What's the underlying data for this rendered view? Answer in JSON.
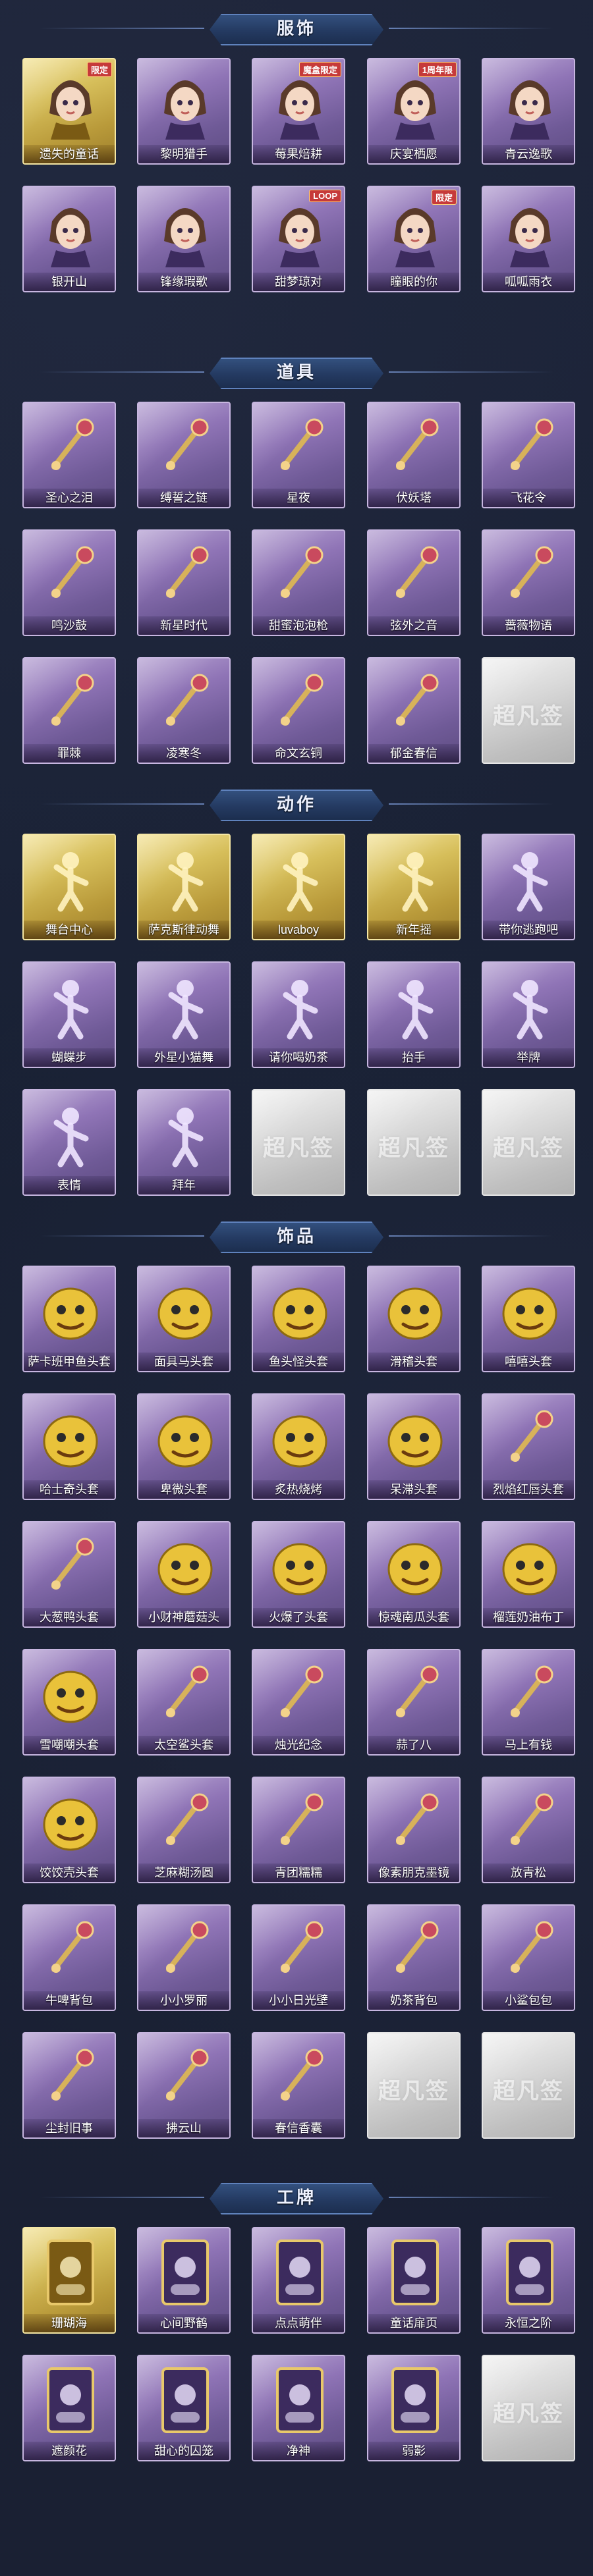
{
  "colors": {
    "purple_card": "#8f74b6",
    "gold_card": "#d6be5a",
    "gray_card": "#d8d8d8",
    "header_plate": "#243a61",
    "background": "#1b2236"
  },
  "placeholder_label": "超凡签",
  "sections": [
    {
      "title": "服饰",
      "items": [
        {
          "label": "遗失的童话",
          "rarity": "gold",
          "badge": "限定",
          "icon": "princess-costume-icon"
        },
        {
          "label": "黎明猎手",
          "rarity": "purple",
          "icon": "hunter-costume-icon"
        },
        {
          "label": "莓果焙耕",
          "rarity": "purple",
          "badge": "魔盒限定",
          "icon": "berry-costume-icon"
        },
        {
          "label": "庆宴栖愿",
          "rarity": "purple",
          "badge": "1周年限",
          "icon": "feast-costume-icon"
        },
        {
          "label": "青云逸歌",
          "rarity": "purple",
          "icon": "cloud-costume-icon"
        },
        {
          "label": "银开山",
          "rarity": "purple",
          "icon": "mountain-costume-icon"
        },
        {
          "label": "锋缘瑕歌",
          "rarity": "purple",
          "icon": "blade-costume-icon"
        },
        {
          "label": "甜梦琼对",
          "rarity": "purple",
          "badge": "LOOP",
          "icon": "dream-costume-icon"
        },
        {
          "label": "瞳眼的你",
          "rarity": "purple",
          "badge": "限定",
          "icon": "cowgirl-costume-icon"
        },
        {
          "label": "呱呱雨衣",
          "rarity": "purple",
          "icon": "frog-raincoat-icon"
        }
      ]
    },
    {
      "title": "道具",
      "items": [
        {
          "label": "圣心之泪",
          "rarity": "purple",
          "icon": "scepter-icon"
        },
        {
          "label": "缚誓之链",
          "rarity": "purple",
          "icon": "chain-icon"
        },
        {
          "label": "星夜",
          "rarity": "purple",
          "icon": "star-staff-icon"
        },
        {
          "label": "伏妖塔",
          "rarity": "purple",
          "icon": "pagoda-icon"
        },
        {
          "label": "飞花令",
          "rarity": "purple",
          "icon": "flower-fan-icon"
        },
        {
          "label": "鸣沙鼓",
          "rarity": "purple",
          "icon": "drum-icon"
        },
        {
          "label": "新星时代",
          "rarity": "purple",
          "icon": "revolver-icon"
        },
        {
          "label": "甜蜜泡泡枪",
          "rarity": "purple",
          "icon": "bubble-gun-icon"
        },
        {
          "label": "弦外之音",
          "rarity": "purple",
          "icon": "guitar-icon"
        },
        {
          "label": "蔷薇物语",
          "rarity": "purple",
          "icon": "first-aid-kit-icon"
        },
        {
          "label": "罪棘",
          "rarity": "purple",
          "icon": "thorn-spear-icon"
        },
        {
          "label": "凌寒冬",
          "rarity": "purple",
          "icon": "ice-sword-icon"
        },
        {
          "label": "命文玄铜",
          "rarity": "purple",
          "icon": "bronze-bell-icon"
        },
        {
          "label": "郁金春信",
          "rarity": "purple",
          "icon": "tulip-umbrella-icon"
        },
        {
          "label": "",
          "rarity": "gray",
          "placeholder": true
        }
      ]
    },
    {
      "title": "动作",
      "items": [
        {
          "label": "舞台中心",
          "rarity": "gold",
          "icon": "pose-center-icon"
        },
        {
          "label": "萨克斯律动舞",
          "rarity": "gold",
          "icon": "pose-sax-icon"
        },
        {
          "label": "luvaboy",
          "rarity": "gold",
          "icon": "pose-heart-icon"
        },
        {
          "label": "新年摇",
          "rarity": "gold",
          "icon": "pose-shake-icon"
        },
        {
          "label": "带你逃跑吧",
          "rarity": "purple",
          "icon": "pose-run-icon"
        },
        {
          "label": "蝴蝶步",
          "rarity": "purple",
          "icon": "pose-butterfly-icon"
        },
        {
          "label": "外星小猫舞",
          "rarity": "purple",
          "icon": "pose-alien-cat-icon"
        },
        {
          "label": "请你喝奶茶",
          "rarity": "purple",
          "icon": "pose-milktea-icon"
        },
        {
          "label": "抬手",
          "rarity": "purple",
          "icon": "pose-raise-hand-icon"
        },
        {
          "label": "举牌",
          "rarity": "purple",
          "icon": "pose-sign-icon"
        },
        {
          "label": "表情",
          "rarity": "purple",
          "icon": "pose-face-icon"
        },
        {
          "label": "拜年",
          "rarity": "purple",
          "icon": "pose-bow-icon"
        },
        {
          "label": "",
          "rarity": "gray",
          "placeholder": true
        },
        {
          "label": "",
          "rarity": "gray",
          "placeholder": true
        },
        {
          "label": "",
          "rarity": "gray",
          "placeholder": true
        }
      ]
    },
    {
      "title": "饰品",
      "items": [
        {
          "label": "萨卡班甲鱼头套",
          "rarity": "purple",
          "icon": "fish-head-icon"
        },
        {
          "label": "面具马头套",
          "rarity": "purple",
          "icon": "horse-head-icon"
        },
        {
          "label": "鱼头怪头套",
          "rarity": "purple",
          "icon": "fish-monster-head-icon"
        },
        {
          "label": "滑稽头套",
          "rarity": "purple",
          "icon": "funny-face-icon"
        },
        {
          "label": "嘻嘻头套",
          "rarity": "purple",
          "icon": "grin-face-icon"
        },
        {
          "label": "哈士奇头套",
          "rarity": "purple",
          "icon": "husky-head-icon"
        },
        {
          "label": "卑微头套",
          "rarity": "purple",
          "icon": "humble-face-icon"
        },
        {
          "label": "炙热烧烤",
          "rarity": "purple",
          "icon": "bbq-head-icon"
        },
        {
          "label": "呆滞头套",
          "rarity": "purple",
          "icon": "dazed-face-icon"
        },
        {
          "label": "烈焰红唇头套",
          "rarity": "purple",
          "icon": "red-lips-icon"
        },
        {
          "label": "大葱鸭头套",
          "rarity": "purple",
          "icon": "scallion-duck-icon"
        },
        {
          "label": "小财神蘑菇头",
          "rarity": "purple",
          "icon": "mushroom-head-icon"
        },
        {
          "label": "火爆了头套",
          "rarity": "purple",
          "icon": "fire-head-icon"
        },
        {
          "label": "惊魂南瓜头套",
          "rarity": "purple",
          "icon": "pumpkin-head-icon"
        },
        {
          "label": "榴莲奶油布丁",
          "rarity": "purple",
          "icon": "pudding-head-icon"
        },
        {
          "label": "雪嘲嘲头套",
          "rarity": "purple",
          "icon": "snowman-head-icon"
        },
        {
          "label": "太空鲨头套",
          "rarity": "purple",
          "icon": "space-shark-icon"
        },
        {
          "label": "烛光纪念",
          "rarity": "purple",
          "icon": "candle-icon"
        },
        {
          "label": "蒜了八",
          "rarity": "purple",
          "icon": "garlic-icon"
        },
        {
          "label": "马上有钱",
          "rarity": "purple",
          "icon": "horse-money-icon"
        },
        {
          "label": "饺饺壳头套",
          "rarity": "purple",
          "icon": "dumpling-head-icon"
        },
        {
          "label": "芝麻糊汤圆",
          "rarity": "purple",
          "icon": "tangyuan-icon"
        },
        {
          "label": "青团糯糯",
          "rarity": "purple",
          "icon": "qingtuan-icon"
        },
        {
          "label": "像素朋克墨镜",
          "rarity": "purple",
          "icon": "pixel-sunglasses-icon"
        },
        {
          "label": "放青松",
          "rarity": "purple",
          "icon": "pine-pot-icon"
        },
        {
          "label": "牛啤背包",
          "rarity": "purple",
          "icon": "beer-backpack-icon"
        },
        {
          "label": "小小罗丽",
          "rarity": "purple",
          "icon": "doll-icon"
        },
        {
          "label": "小小日光壁",
          "rarity": "purple",
          "icon": "sun-doll-icon"
        },
        {
          "label": "奶茶背包",
          "rarity": "purple",
          "icon": "milktea-backpack-icon"
        },
        {
          "label": "小鲨包包",
          "rarity": "purple",
          "icon": "shark-bag-icon"
        },
        {
          "label": "尘封旧事",
          "rarity": "purple",
          "icon": "mini-figure-icon"
        },
        {
          "label": "拂云山",
          "rarity": "purple",
          "icon": "cloud-charm-icon"
        },
        {
          "label": "春信香囊",
          "rarity": "purple",
          "icon": "sachet-icon"
        },
        {
          "label": "",
          "rarity": "gray",
          "placeholder": true
        },
        {
          "label": "",
          "rarity": "gray",
          "placeholder": true
        }
      ]
    },
    {
      "title": "工牌",
      "items": [
        {
          "label": "珊瑚海",
          "rarity": "gold",
          "icon": "coral-card-icon"
        },
        {
          "label": "心间野鹤",
          "rarity": "purple",
          "icon": "crane-card-icon"
        },
        {
          "label": "点点萌伴",
          "rarity": "purple",
          "icon": "companion-card-icon"
        },
        {
          "label": "童话扉页",
          "rarity": "purple",
          "icon": "fairytale-card-icon"
        },
        {
          "label": "永恒之阶",
          "rarity": "purple",
          "icon": "eternal-card-icon"
        },
        {
          "label": "遮颜花",
          "rarity": "purple",
          "icon": "flower-card-icon"
        },
        {
          "label": "甜心的囚笼",
          "rarity": "purple",
          "icon": "cage-card-icon"
        },
        {
          "label": "净神",
          "rarity": "purple",
          "icon": "silhouette-card-icon"
        },
        {
          "label": "弱影",
          "rarity": "purple",
          "icon": "shadow-card-icon"
        },
        {
          "label": "",
          "rarity": "gray",
          "placeholder": true
        }
      ]
    }
  ]
}
